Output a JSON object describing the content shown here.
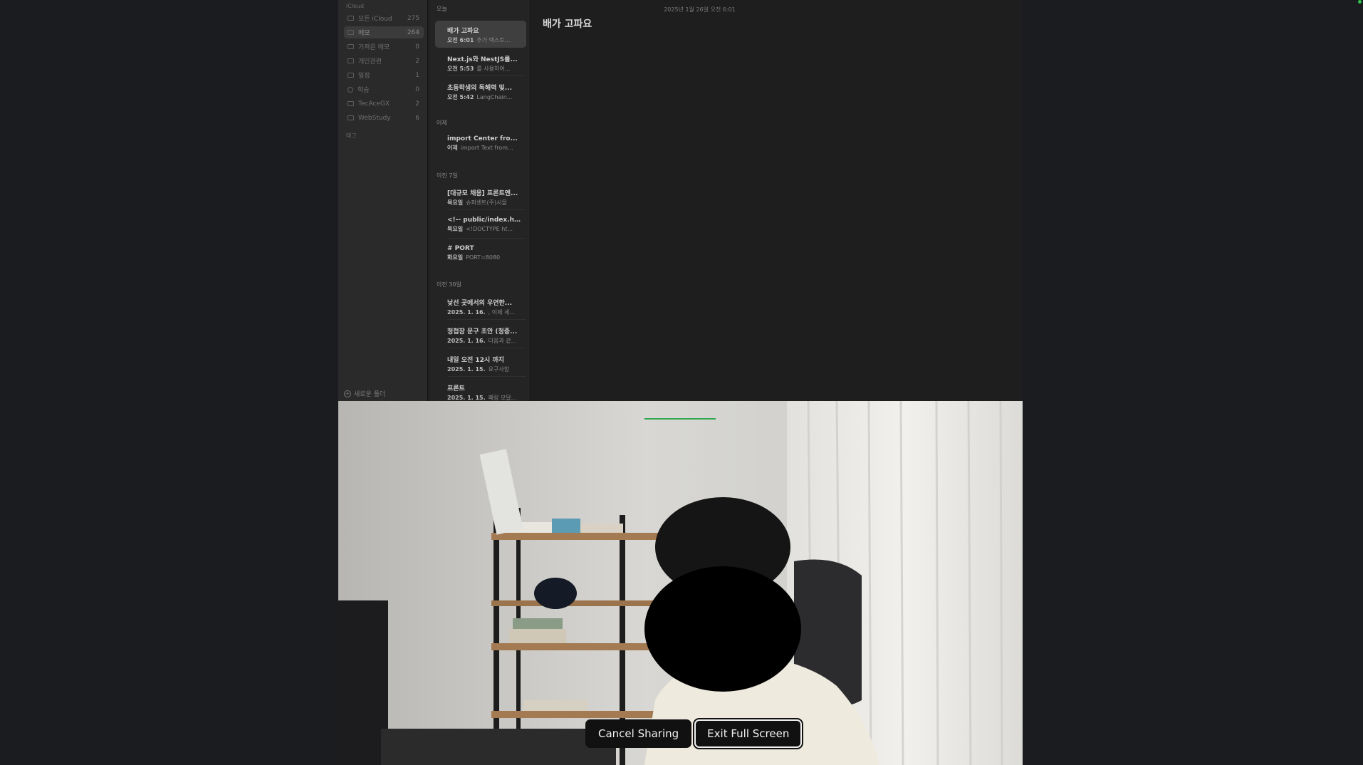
{
  "sidebar": {
    "section_label": "iCloud",
    "folders": [
      {
        "label": "모든 iCloud",
        "count": "275",
        "icon": "folder-icon"
      },
      {
        "label": "메모",
        "count": "264",
        "icon": "folder-icon",
        "selected": true
      },
      {
        "label": "가져온 메모",
        "count": "0",
        "icon": "folder-icon"
      },
      {
        "label": "개인관련",
        "count": "2",
        "icon": "folder-icon"
      },
      {
        "label": "일정",
        "count": "1",
        "icon": "folder-icon"
      },
      {
        "label": "학습",
        "count": "0",
        "icon": "gear-icon"
      },
      {
        "label": "TecAceGX",
        "count": "2",
        "icon": "folder-icon"
      },
      {
        "label": "WebStudy",
        "count": "6",
        "icon": "folder-icon"
      }
    ],
    "tags_label": "태그",
    "new_folder_label": "새로운 폴더"
  },
  "note_list": {
    "groups": [
      {
        "label": "오늘",
        "notes": [
          {
            "title": "배가 고파요",
            "date": "오전 6:01",
            "preview": "추가 텍스트...",
            "selected": true
          },
          {
            "title": "Next.js와 NestJS를...",
            "date": "오전 5:53",
            "preview": "를 사용하여..."
          },
          {
            "title": "초등학생의 독해력 및...",
            "date": "오전 5:42",
            "preview": "LangChain..."
          }
        ]
      },
      {
        "label": "어제",
        "notes": [
          {
            "title": "import Center fro...",
            "date": "어제",
            "preview": "import Text from..."
          }
        ]
      },
      {
        "label": "이전 7일",
        "notes": [
          {
            "title": "[대규모 채용] 프론트엔...",
            "date": "목요일",
            "preview": "슈퍼센트(주)시몰"
          },
          {
            "title": "<!-- public/index.h...",
            "date": "목요일",
            "preview": "<!DOCTYPE ht..."
          },
          {
            "title": "# PORT",
            "date": "화요일",
            "preview": "PORT=8080"
          }
        ]
      },
      {
        "label": "이전 30일",
        "notes": [
          {
            "title": "낯선 곳에서의 우연한...",
            "date": "2025. 1. 16.",
            "preview": ", 이제 세..."
          },
          {
            "title": "청첩장 문구 초안 (청중...",
            "date": "2025. 1. 16.",
            "preview": "다음과 같..."
          },
          {
            "title": "내일 오전 12시 까지",
            "date": "2025. 1. 15.",
            "preview": "요구사항"
          },
          {
            "title": "프론트",
            "date": "2025. 1. 15.",
            "preview": "패링 모달..."
          }
        ]
      }
    ]
  },
  "editor": {
    "date": "2025년 1월 26일 오전 6:01",
    "title": "배가 고파요"
  },
  "share_controls": {
    "cancel_label": "Cancel Sharing",
    "exit_label": "Exit Full Screen"
  },
  "colors": {
    "accent_green": "#2fa84f",
    "background": "#1a1c1f"
  }
}
